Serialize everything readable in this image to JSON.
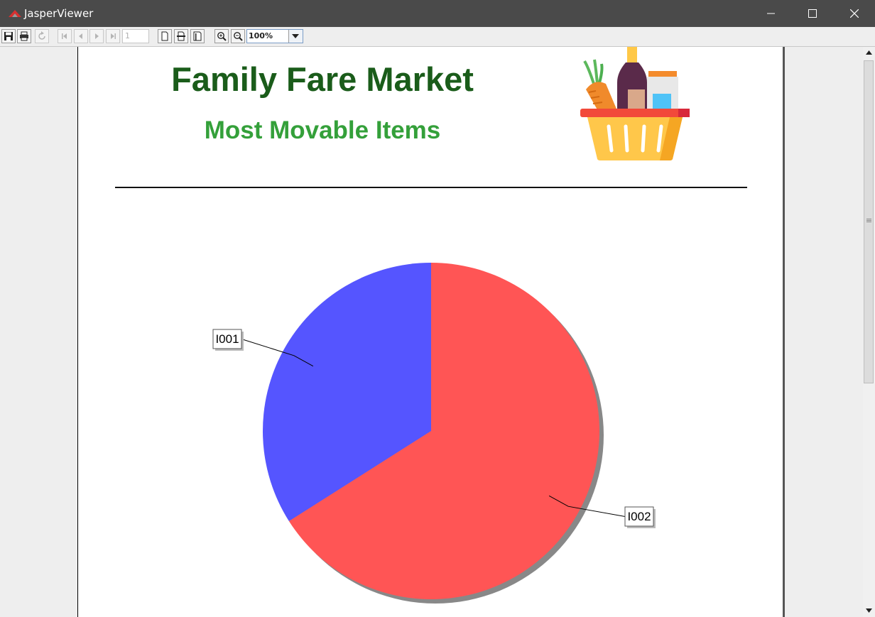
{
  "window": {
    "title": "JasperViewer",
    "controls": [
      "minimize",
      "maximize",
      "close"
    ],
    "icon": "jasper-logo-icon"
  },
  "toolbar": {
    "buttons": [
      {
        "name": "save-icon",
        "enabled": true
      },
      {
        "name": "print-icon",
        "enabled": true
      },
      {
        "name": "reload-icon",
        "enabled": false
      },
      {
        "name": "first-page-icon",
        "enabled": false
      },
      {
        "name": "previous-page-icon",
        "enabled": false
      },
      {
        "name": "next-page-icon",
        "enabled": false
      },
      {
        "name": "last-page-icon",
        "enabled": false
      },
      {
        "name": "actual-size-icon",
        "enabled": true
      },
      {
        "name": "fit-page-icon",
        "enabled": true
      },
      {
        "name": "fit-width-icon",
        "enabled": true
      },
      {
        "name": "zoom-in-icon",
        "enabled": true
      },
      {
        "name": "zoom-out-icon",
        "enabled": true
      }
    ],
    "page_number": "1",
    "zoom": "100%"
  },
  "report": {
    "title": "Family Fare Market",
    "subtitle": "Most Movable Items",
    "logo": "grocery-basket-icon"
  },
  "chart_data": {
    "type": "pie",
    "title": "",
    "slices": [
      {
        "label": "I001",
        "value": 34,
        "color": "#5555ff"
      },
      {
        "label": "I002",
        "value": 66,
        "color": "#ff5555"
      }
    ],
    "start_angle_deg": 0,
    "direction": "counterclockwise",
    "shadow": true,
    "legend": "none"
  },
  "colors": {
    "title": "#1a5c1a",
    "subtitle": "#34a03a",
    "titlebar": "#4a4a4a"
  }
}
